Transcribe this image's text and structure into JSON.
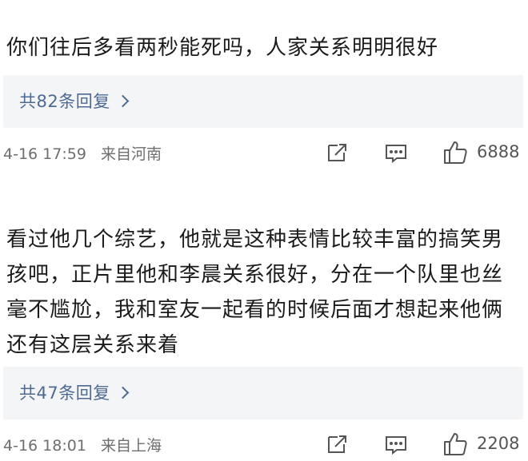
{
  "comments": [
    {
      "text": "你们往后多看两秒能死吗，人家关系明明很好",
      "replies_label": "共82条回复",
      "time": "4-16 17:59",
      "location": "来自河南",
      "likes": "6888"
    },
    {
      "text": "看过他几个综艺，他就是这种表情比较丰富的搞笑男孩吧，正片里他和李晨关系很好，分在一个队里也丝毫不尴尬，我和室友一起看的时候后面才想起来他俩还有这层关系来着",
      "replies_label": "共47条回复",
      "time": "4-16 18:01",
      "location": "来自上海",
      "likes": "2208"
    }
  ],
  "icons": {
    "share": "share-icon",
    "comment": "comment-icon",
    "like": "thumbs-up-icon",
    "more": "chevron-right-icon"
  },
  "colors": {
    "link": "#4c6a94",
    "meta": "#6e6e6e",
    "reply_bg": "#f4f5f7"
  }
}
